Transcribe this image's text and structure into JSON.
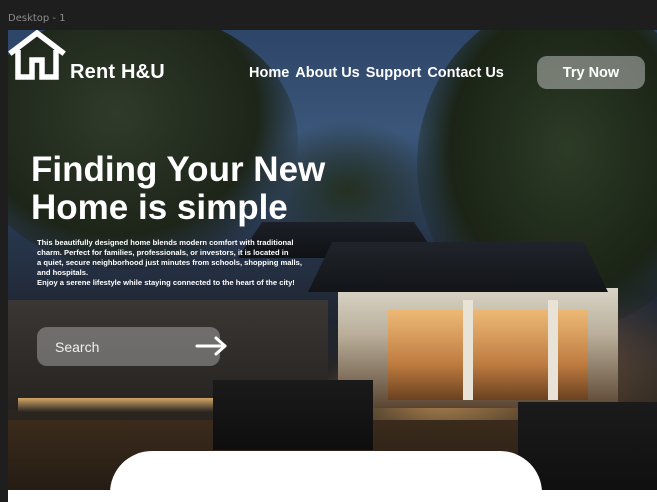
{
  "canvas": {
    "frame_label": "Desktop - 1"
  },
  "header": {
    "brand": "Rent H&U",
    "nav": [
      {
        "label": "Home"
      },
      {
        "label": "About Us"
      },
      {
        "label": "Support"
      },
      {
        "label": "Contact Us"
      }
    ],
    "cta_label": "Try Now"
  },
  "hero": {
    "headline": "Finding Your New\nHome is simple",
    "description": "This beautifully designed home blends modern comfort with traditional\n charm. Perfect for families, professionals, or investors, it is located in\na quiet, secure neighborhood just minutes from schools, shopping malls,\n and hospitals.\nEnjoy a serene lifestyle while staying connected to the heart of the city!",
    "search": {
      "placeholder": "Search",
      "icon": "arrow-right-icon"
    }
  },
  "icons": {
    "logo": "house-icon"
  },
  "colors": {
    "text": "#ffffff",
    "canvas": "#1e1e1e",
    "label": "#8c8c8c"
  }
}
